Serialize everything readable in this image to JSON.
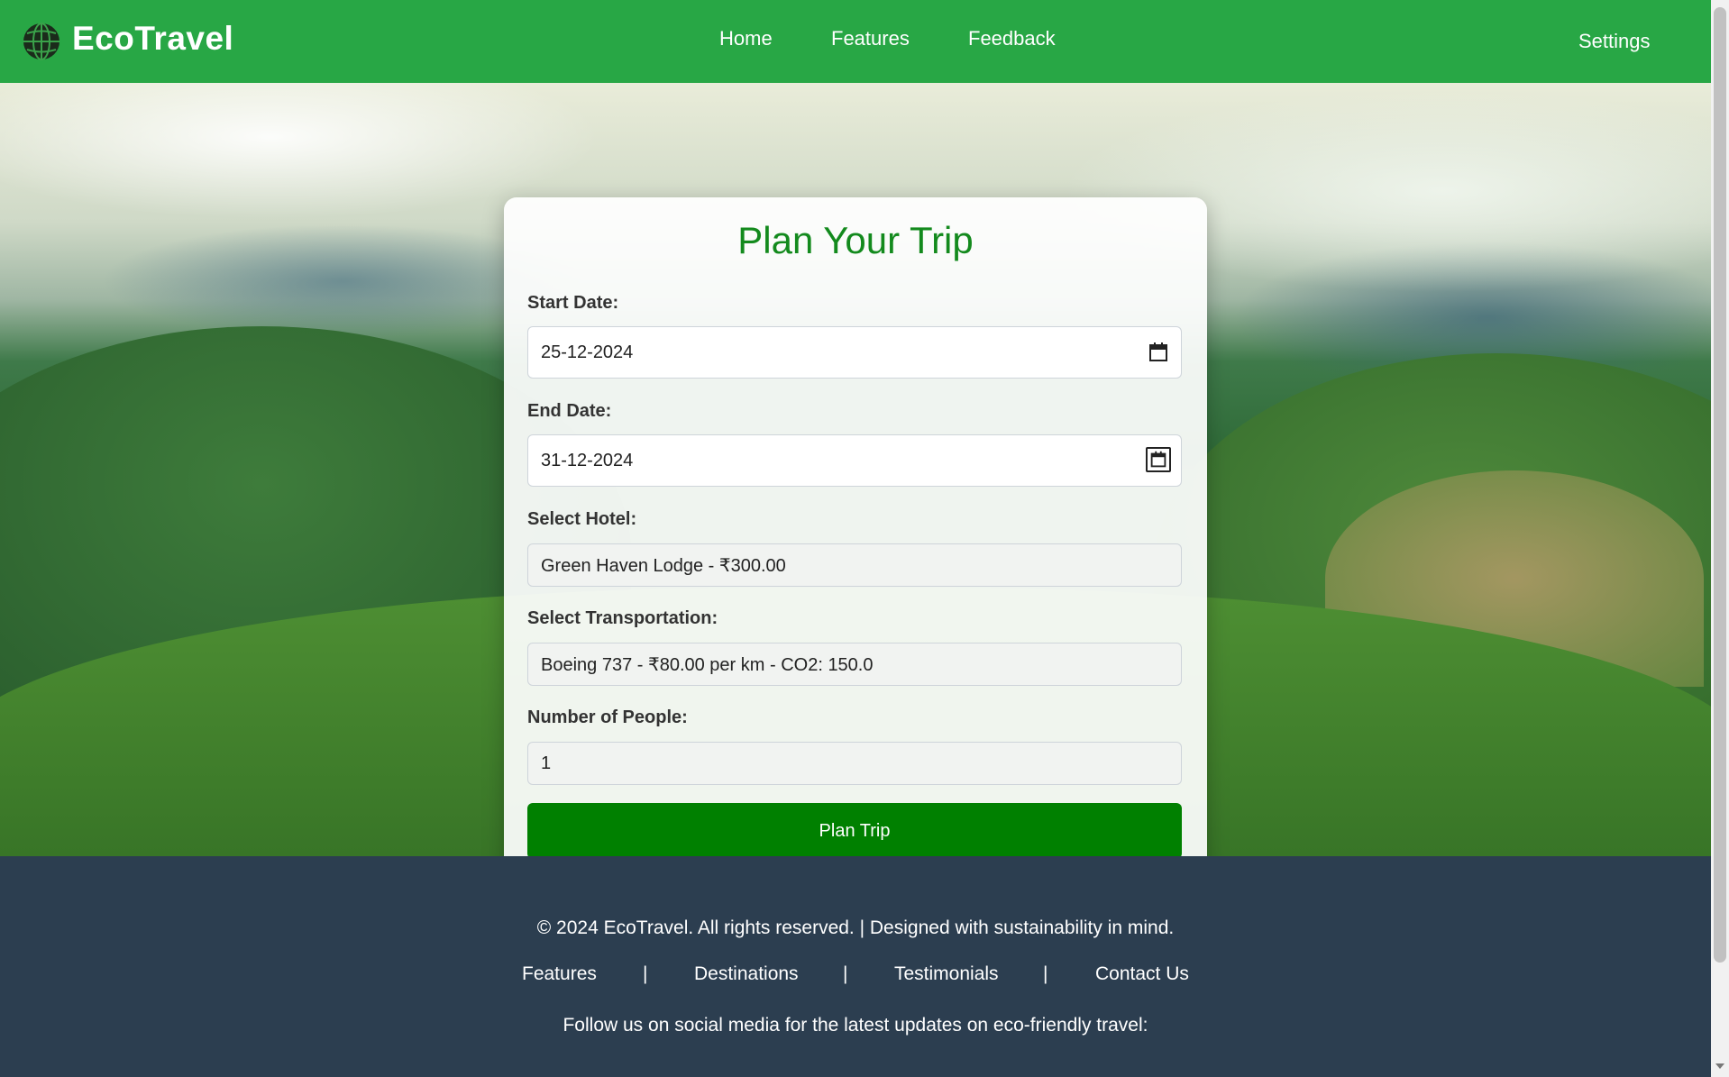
{
  "header": {
    "brand": "EcoTravel",
    "nav": [
      "Home",
      "Features",
      "Feedback"
    ],
    "settings": "Settings",
    "color": "#28a745"
  },
  "form": {
    "title": "Plan Your Trip",
    "start_date_label": "Start Date:",
    "start_date_value": "25-12-2024",
    "end_date_label": "End Date:",
    "end_date_value": "31-12-2024",
    "hotel_label": "Select Hotel:",
    "hotel_value": "Green Haven Lodge - ₹300.00",
    "transport_label": "Select Transportation:",
    "transport_value": "Boeing 737 - ₹80.00 per km - CO2: 150.0",
    "people_label": "Number of People:",
    "people_value": "1",
    "submit_label": "Plan Trip",
    "accent": "#008000"
  },
  "footer": {
    "copyright": "© 2024 EcoTravel. All rights reserved. | Designed with sustainability in mind.",
    "links": [
      "Features",
      "Destinations",
      "Testimonials",
      "Contact Us"
    ],
    "separator": "|",
    "follow": "Follow us on social media for the latest updates on eco-friendly travel:",
    "color": "#2c3e50"
  }
}
